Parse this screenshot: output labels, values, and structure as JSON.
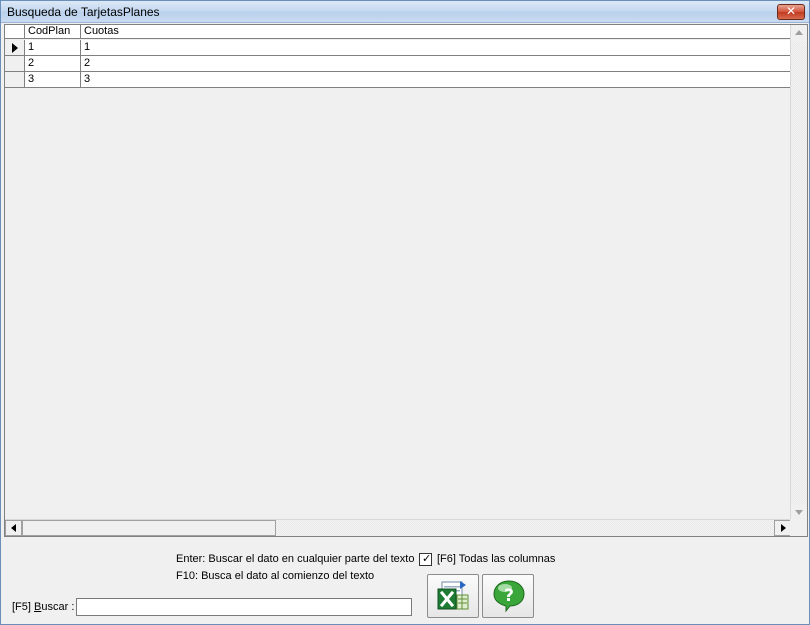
{
  "window": {
    "title": "Busqueda de TarjetasPlanes",
    "close_icon": "close-icon"
  },
  "grid": {
    "columns": [
      "CodPlan",
      "Cuotas"
    ],
    "rows": [
      {
        "cells": [
          "1",
          "1"
        ],
        "current": true
      },
      {
        "cells": [
          "2",
          "2"
        ],
        "current": false
      },
      {
        "cells": [
          "3",
          "3"
        ],
        "current": false
      }
    ]
  },
  "hints": {
    "enter": "Enter: Buscar el dato en cualquier parte del texto",
    "f10": "F10: Busca el dato al comienzo del texto"
  },
  "options": {
    "all_columns_label": "[F6]  Todas las columnas",
    "all_columns_checked": true
  },
  "search": {
    "label_prefix": "[F5] ",
    "label_accel": "B",
    "label_rest": "uscar :",
    "value": ""
  },
  "buttons": {
    "excel_icon": "excel-export-icon",
    "help_icon": "help-icon"
  },
  "colors": {
    "excel_green": "#1e7b34",
    "help_green": "#3aa63a"
  }
}
